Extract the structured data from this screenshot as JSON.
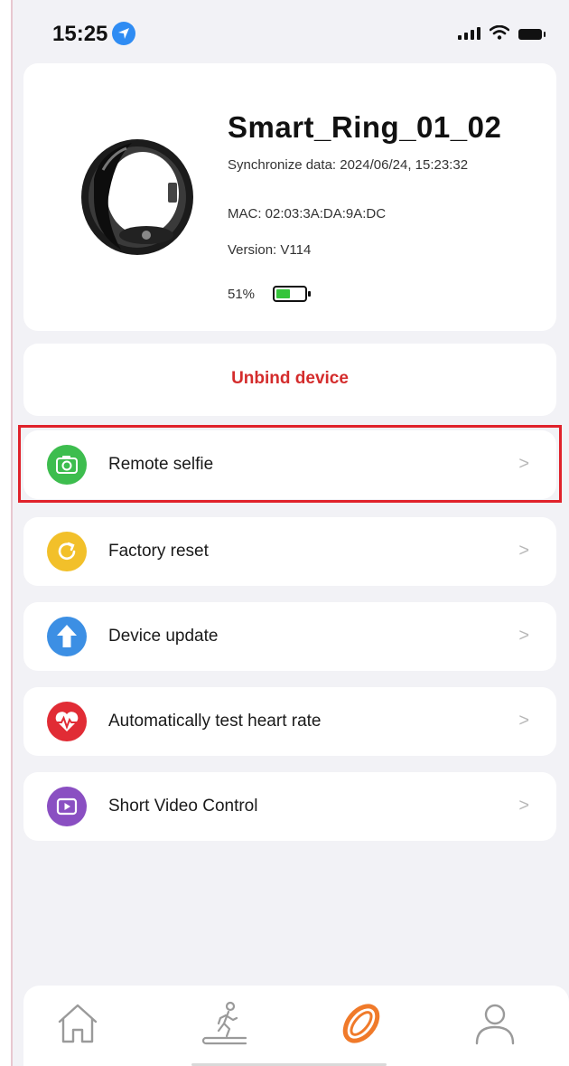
{
  "status_bar": {
    "time": "15:25"
  },
  "device": {
    "name": "Smart_Ring_01_02",
    "sync": "Synchronize data: 2024/06/24, 15:23:32",
    "mac": "MAC: 02:03:3A:DA:9A:DC",
    "version": "Version: V114",
    "battery_text": "51%",
    "battery_level": 0.51
  },
  "unbind_label": "Unbind device",
  "menu": [
    {
      "label": "Remote selfie",
      "icon": "camera-icon",
      "color": "#3dbd4e",
      "chevron": ">"
    },
    {
      "label": "Factory reset",
      "icon": "reset-icon",
      "color": "#f2c02a",
      "chevron": ">"
    },
    {
      "label": "Device update",
      "icon": "upload-arrow-icon",
      "color": "#3c8fe4",
      "chevron": ">"
    },
    {
      "label": "Automatically test heart rate",
      "icon": "heart-rate-icon",
      "color": "#e12c35",
      "chevron": ">"
    },
    {
      "label": "Short Video Control",
      "icon": "video-play-icon",
      "color": "#8a4fc2",
      "chevron": ">"
    }
  ],
  "tabs": [
    {
      "icon": "home-icon",
      "active": false
    },
    {
      "icon": "exercise-icon",
      "active": false
    },
    {
      "icon": "ring-icon",
      "active": true,
      "color": "#f07a2a"
    },
    {
      "icon": "profile-icon",
      "active": false
    }
  ],
  "highlight_color": "#e0222b"
}
